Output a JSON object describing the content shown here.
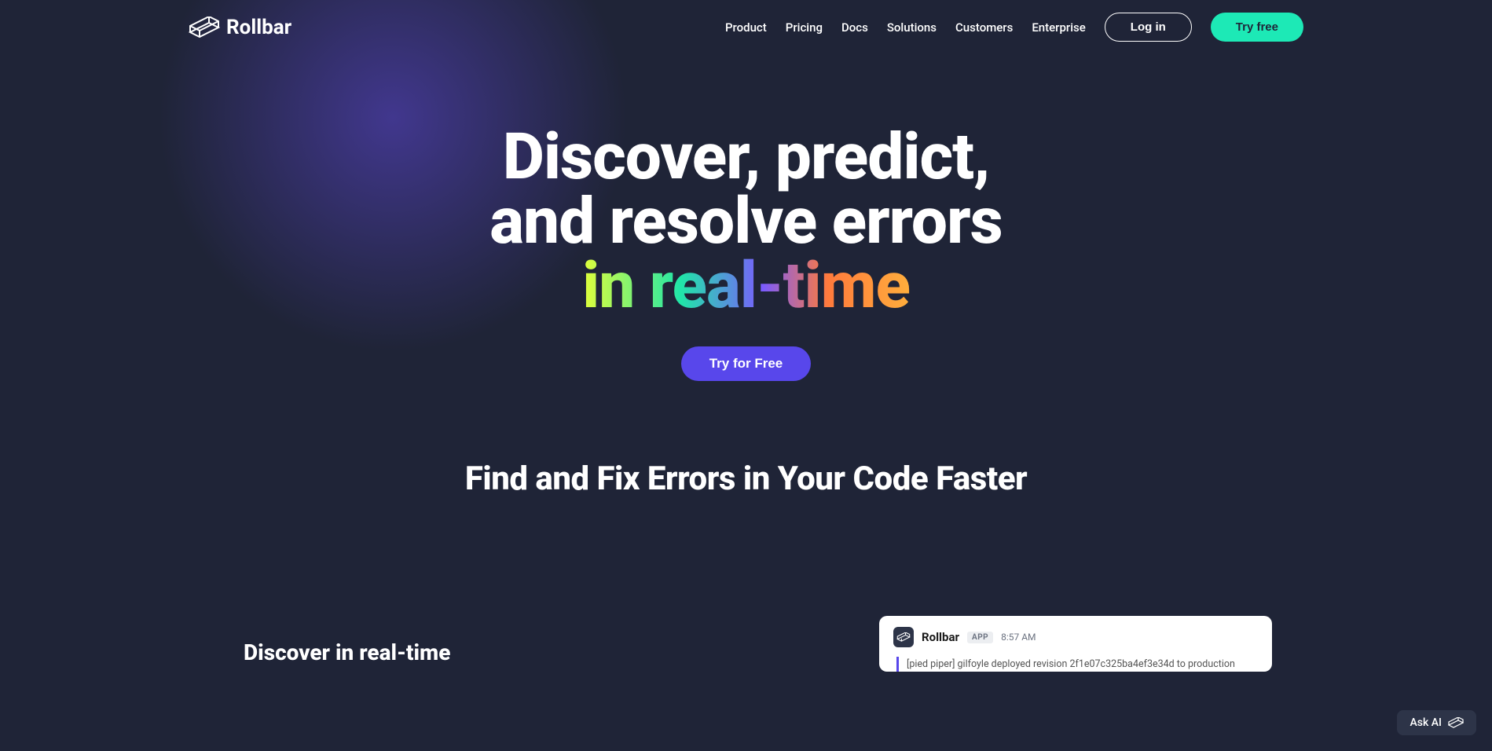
{
  "brand": "Rollbar",
  "nav": {
    "links": [
      "Product",
      "Pricing",
      "Docs",
      "Solutions",
      "Customers",
      "Enterprise"
    ],
    "login": "Log in",
    "tryfree": "Try free"
  },
  "hero": {
    "line1": "Discover, predict,",
    "line2": "and resolve errors",
    "line3": "in real-time",
    "cta": "Try for Free"
  },
  "subheading": "Find and Fix Errors in Your Code Faster",
  "discover": {
    "title": "Discover in real-time"
  },
  "card": {
    "name": "Rollbar",
    "badge": "APP",
    "time": "8:57 AM",
    "message": "[pied piper] gilfoyle deployed revision 2f1e07c325ba4ef3e34d to production"
  },
  "askai": "Ask AI"
}
